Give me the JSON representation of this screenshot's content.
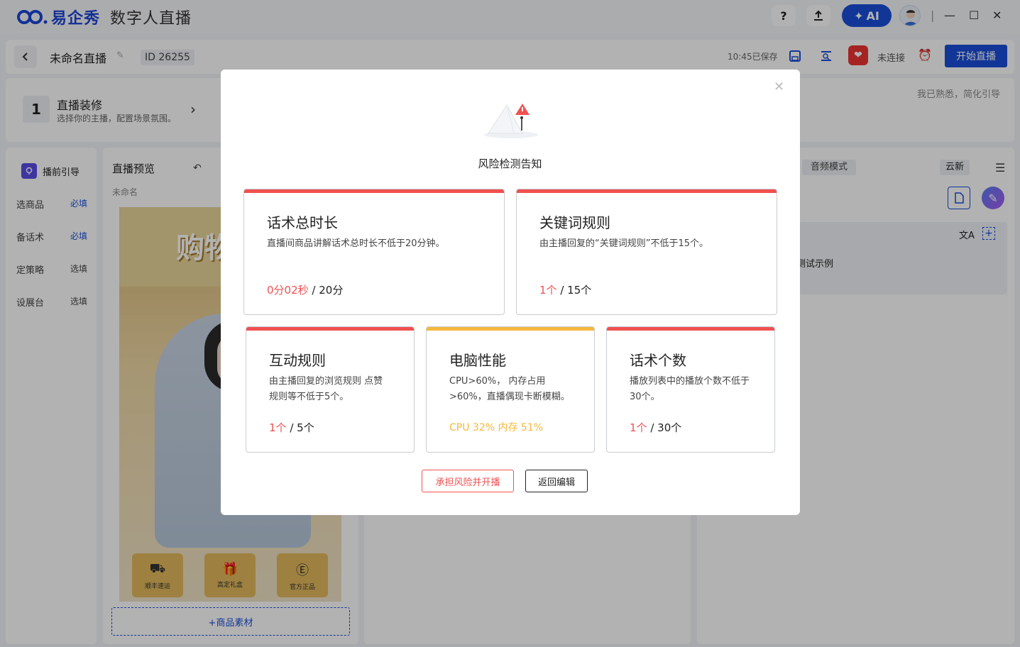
{
  "app": {
    "brand": "易企秀",
    "product": "数字人直播"
  },
  "topbar": {
    "help": "?",
    "ai_label": "AI"
  },
  "header": {
    "title": "未命名直播",
    "id_label": "ID",
    "id_value": "26255",
    "saved": "10:45已保存",
    "connection": "未连接",
    "start_button": "开始直播"
  },
  "step": {
    "number": "1",
    "title": "直播装修",
    "subtitle": "选择你的主播，配置场景氛围。",
    "skip": "我已熟悉，简化引导"
  },
  "leftnav": {
    "header": "播前引导",
    "items": [
      {
        "label": "选商品",
        "tag": "必填"
      },
      {
        "label": "备话术",
        "tag": "必填"
      },
      {
        "label": "定策略",
        "tag": "选填"
      },
      {
        "label": "设展台",
        "tag": "选填"
      }
    ]
  },
  "preview": {
    "title": "直播预览",
    "subtitle": "未命名",
    "banner_text": "购物",
    "features": [
      {
        "label": "顺丰速运"
      },
      {
        "label": "高定礼盒"
      },
      {
        "label": "官方正品"
      }
    ],
    "add_material": "+商品素材"
  },
  "right": {
    "audio_mode": "音频模式",
    "cloud": "云新",
    "example": "测试示例"
  },
  "modal": {
    "title": "风险检测告知",
    "cards": [
      {
        "title": "话术总时长",
        "desc": "直播间商品讲解话术总时长不低于20分钟。",
        "current": "0分02秒",
        "target": "/ 20分",
        "status_color": "#f15050"
      },
      {
        "title": "关键词规则",
        "desc": "由主播回复的“关键词规则”不低于15个。",
        "current": "1个",
        "target": "/ 15个",
        "status_color": "#f15050"
      },
      {
        "title": "互动规则",
        "desc": "由主播回复的浏览规则 点赞规则等不低于5个。",
        "current": "1个",
        "target": "/ 5个",
        "status_color": "#f15050"
      },
      {
        "title": "电脑性能",
        "desc": "CPU>60%， 内存占用>60%，直播偶现卡断模糊。",
        "current": "CPU 32% 内存 51%",
        "target": "",
        "status_color": "#f5b83c"
      },
      {
        "title": "话术个数",
        "desc": "播放列表中的播放个数不低于30个。",
        "current": "1个",
        "target": "/ 30个",
        "status_color": "#f15050"
      }
    ],
    "accept_button": "承担风险并开播",
    "back_button": "返回编辑"
  }
}
